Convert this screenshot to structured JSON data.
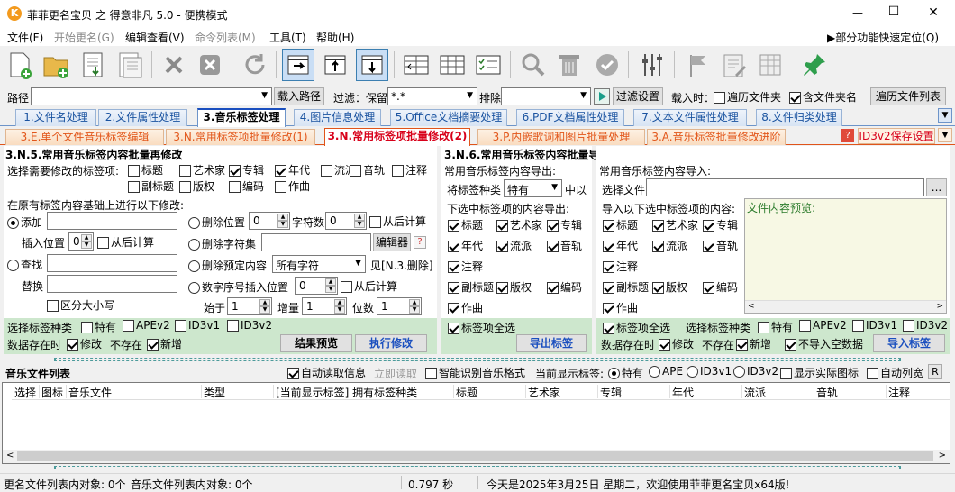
{
  "window": {
    "title": "菲菲更名宝贝 之 得意非凡 5.0 - 便携模式",
    "min": "—",
    "max": "☐",
    "close": "✕"
  },
  "menu": {
    "items": [
      "文件(F)",
      "开始更名(G)",
      "编辑查看(V)",
      "命令列表(M)",
      "工具(T)",
      "帮助(H)"
    ],
    "quick": "▶部分功能快速定位(Q)"
  },
  "pathbar": {
    "path_label": "路径",
    "path_value": "",
    "load_btn": "载入路径",
    "filter_label": "过滤：保留",
    "filter_value": "*.*",
    "exclude_label": "排除",
    "exclude_value": "",
    "filter_btn": "过滤设置",
    "on_load_label": "载入时：",
    "walk_folders": "遍历文件夹",
    "include_folder_names": "含文件夹名",
    "walk_list_btn": "遍历文件列表"
  },
  "tabs": [
    "1.文件名处理",
    "2.文件属性处理",
    "3.音乐标签处理",
    "4.图片信息处理",
    "5.Office文档摘要处理",
    "6.PDF文档属性处理",
    "7.文本文件属性处理",
    "8.文件归类处理"
  ],
  "subtabs": [
    "3.E.单个文件音乐标签编辑",
    "3.N.常用标签项批量修改(1)",
    "3.N.常用标签项批量修改(2)",
    "3.P.内嵌歌词和图片批量处理",
    "3.A.音乐标签批量修改进阶"
  ],
  "subtab_help": "?",
  "id3_save": "ID3v2保存设置",
  "left": {
    "title": "3.N.5.常用音乐标签内容批量再修改",
    "select_label": "选择需要修改的标签项:",
    "fields_row1": [
      "标题",
      "艺术家",
      "专辑",
      "年代",
      "流派",
      "音轨",
      "注释"
    ],
    "fields_row2": [
      "副标题",
      "版权",
      "编码",
      "作曲"
    ],
    "base_label": "在原有标签内容基础上进行以下修改:",
    "add": "添加",
    "insert_pos": "插入位置",
    "from_end": "从后计算",
    "find": "查找",
    "replace": "替换",
    "case": "区分大小写",
    "del_pos": "删除位置",
    "del_chars": "字符数",
    "del_charset": "删除字符集",
    "editor_btn": "编辑器",
    "del_preset": "删除预定内容",
    "preset_value": "所有字符",
    "see": "见[N.3.删除]",
    "num_insert": "数字序号插入位置",
    "start": "始于",
    "step": "增量",
    "digits": "位数",
    "spin_insert": "0",
    "spin_delpos": "0",
    "spin_delcnt": "0",
    "spin_num": "0",
    "spin_start": "1",
    "spin_step": "1",
    "spin_digits": "1",
    "tagtype_label": "选择标签种类",
    "tagtypes": [
      "特有",
      "APEv2",
      "ID3v1",
      "ID3v2"
    ],
    "store_label": "数据存在时",
    "modify": "修改",
    "notexist": "不存在",
    "newadd": "新增",
    "preview_btn": "结果预览",
    "exec_btn": "执行修改"
  },
  "mid": {
    "title": "3.N.6.常用音乐标签内容批量导出和导入",
    "export_label": "常用音乐标签内容导出:",
    "tagtype_lbl": "将标签种类",
    "tagtype_val": "特有",
    "as_lbl": "中以",
    "export_sel": "下选中标签项的内容导出:",
    "fields": [
      "标题",
      "艺术家",
      "专辑",
      "年代",
      "流派",
      "音轨",
      "注释",
      "副标题",
      "版权",
      "编码",
      "作曲"
    ],
    "select_all": "标签项全选",
    "export_btn": "导出标签"
  },
  "right": {
    "import_label": "常用音乐标签内容导入:",
    "choose_file": "选择文件",
    "browse": "...",
    "import_sel": "导入以下选中标签项的内容:",
    "preview_label": "文件内容预览:",
    "fields": [
      "标题",
      "艺术家",
      "专辑",
      "年代",
      "流派",
      "音轨",
      "注释",
      "副标题",
      "版权",
      "编码",
      "作曲"
    ],
    "select_all": "标签项全选",
    "tagtype_label": "选择标签种类",
    "tagtypes": [
      "特有",
      "APEv2",
      "ID3v1",
      "ID3v2"
    ],
    "store_label": "数据存在时",
    "modify": "修改",
    "notexist": "不存在",
    "newadd": "新增",
    "no_empty": "不导入空数据",
    "import_btn": "导入标签"
  },
  "list": {
    "title": "音乐文件列表",
    "auto_read": "自动读取信息",
    "read_now": "立即读取",
    "smart": "智能识别音乐格式",
    "current": "当前显示标签:",
    "opts": [
      "特有",
      "APE",
      "ID3v1",
      "ID3v2"
    ],
    "show_icon": "显示实际图标",
    "auto_col": "自动列宽",
    "r": "R",
    "columns": [
      "选择",
      "图标",
      "音乐文件",
      "类型",
      "[当前显示标签] 拥有标签种类",
      "标题",
      "艺术家",
      "专辑",
      "年代",
      "流派",
      "音轨",
      "注释"
    ]
  },
  "status": {
    "s1": "更名文件列表内对象: 0个",
    "s2": "音乐文件列表内对象: 0个",
    "time": "0.797 秒",
    "msg": "今天是2025年3月25日 星期二，欢迎使用菲菲更名宝贝x64版!"
  }
}
